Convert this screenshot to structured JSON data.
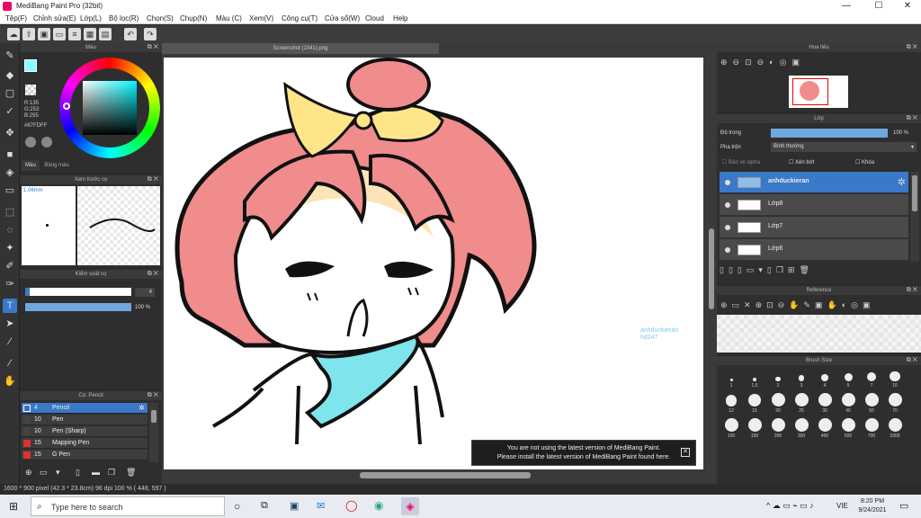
{
  "title": "MediBang Paint Pro (32bit)",
  "menu": [
    "Tệp(F)",
    "Chỉnh sửa(E)",
    "Lớp(L)",
    "Bộ lọc(R)",
    "Chọn(S)",
    "Chụp(N)",
    "Màu (C)",
    "Xem(V)",
    "Công cụ(T)",
    "Cửa sổ(W)",
    "Cloud",
    "Help"
  ],
  "document_tab": "Screenshot (1041).png",
  "color_panel": {
    "title": "Màu",
    "rgb": [
      "R:135",
      "G:253",
      "B:255"
    ],
    "hex": "#87FDFF",
    "tabs": [
      "Màu",
      "Bảng màu"
    ],
    "fg_color": "#87FDFF"
  },
  "preview_panel": {
    "title": "Xem trước cọ",
    "size": "1.06mm"
  },
  "control_panel": {
    "title": "Kiểm soát cọ",
    "size_value": "4",
    "opacity": "100 %"
  },
  "brush_panel": {
    "title": "Cọ: Pencil",
    "items": [
      {
        "color": "#3a6fc4",
        "size": "4",
        "name": "Pencil",
        "selected": true
      },
      {
        "color": "#444444",
        "size": "10",
        "name": "Pen"
      },
      {
        "color": "#444444",
        "size": "10",
        "name": "Pen (Sharp)"
      },
      {
        "color": "#e03030",
        "size": "15",
        "name": "Mapping Pen"
      },
      {
        "color": "#e03030",
        "size": "15",
        "name": "G Pen"
      }
    ]
  },
  "navigator": {
    "title": "Hoa tiêu"
  },
  "layer_panel": {
    "title": "Lớp",
    "opacity_label": "Độ trong",
    "opacity": "100 %",
    "blend_label": "Pha trộn",
    "blend": "Bình thường",
    "checks": [
      "Bảo vệ alpha",
      "Xén bớt",
      "Khóa"
    ],
    "layers": [
      "anhduckieran",
      "Lớp8",
      "Lớp7",
      "Lớp6"
    ]
  },
  "reference": {
    "title": "Reference"
  },
  "brush_size": {
    "title": "Brush Size",
    "sizes": [
      "1",
      "1.5",
      "2",
      "3",
      "4",
      "5",
      "7",
      "10",
      "12",
      "15",
      "20",
      "25",
      "30",
      "40",
      "50",
      "70",
      "100",
      "150",
      "200",
      "300",
      "400",
      "500",
      "700",
      "1000"
    ]
  },
  "watermark": [
    "anhduckieran",
    "hd247"
  ],
  "notice": [
    "You are not using the latest version of MediBang Paint.",
    "Please install the latest version of MediBang Paint found here."
  ],
  "status": "1600 * 900 pixel   (42.3 * 23.8cm)   96 dpi   100 %   ( 448, 597 )",
  "taskbar": {
    "search": "Type here to search",
    "lang": "VIE",
    "time": "8:20 PM",
    "date": "9/24/2021"
  }
}
